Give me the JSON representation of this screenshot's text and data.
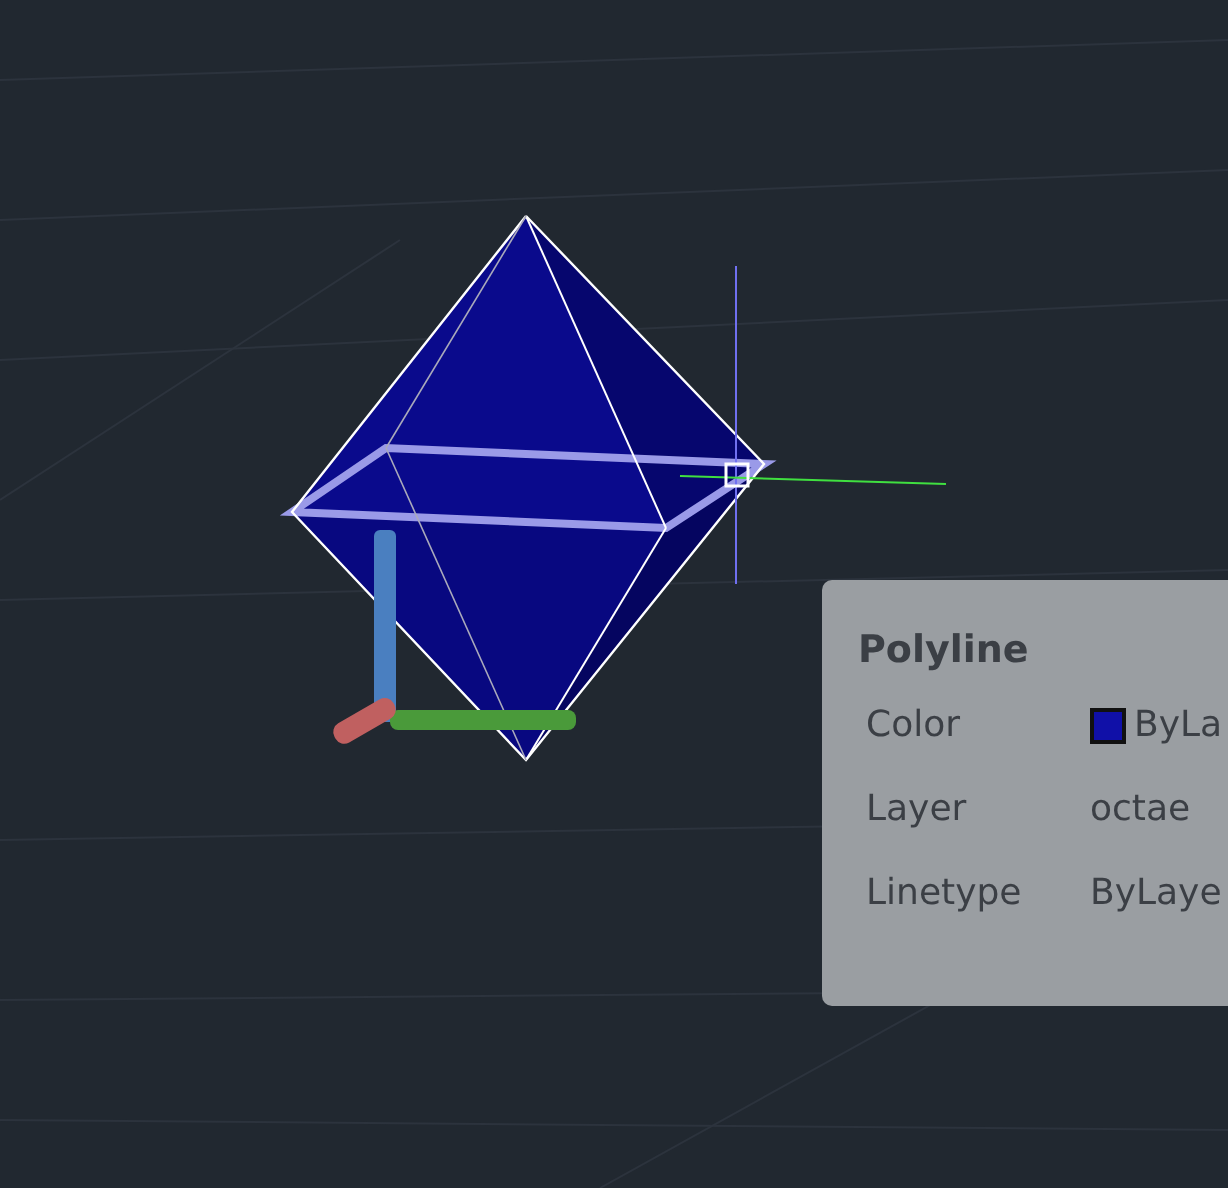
{
  "tooltip": {
    "title": "Polyline",
    "rows": [
      {
        "label": "Color",
        "value": "ByLa",
        "color": "#1010a8"
      },
      {
        "label": "Layer",
        "value": "octae"
      },
      {
        "label": "Linetype",
        "value": "ByLaye"
      }
    ]
  }
}
